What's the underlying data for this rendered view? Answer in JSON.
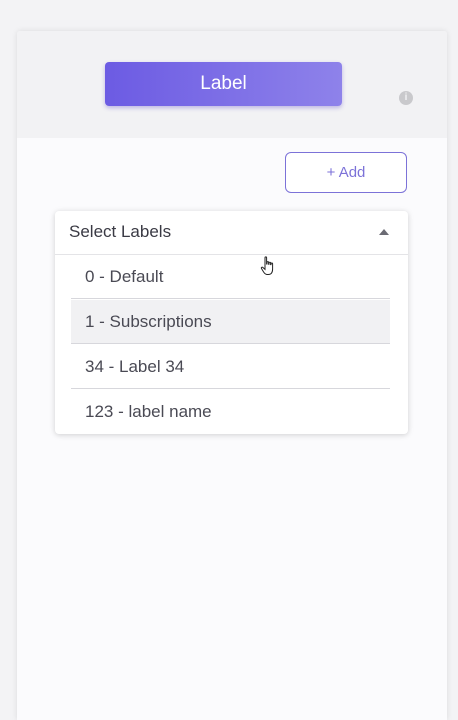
{
  "header": {
    "label_button": "Label",
    "info_icon": "info-icon",
    "info_glyph": "i"
  },
  "toolbar": {
    "add_label": "+ Add"
  },
  "select": {
    "placeholder": "Select Labels",
    "caret_icon": "caret-up-icon",
    "options": [
      {
        "label": "0 - Default"
      },
      {
        "label": "1 - Subscriptions",
        "highlighted": true
      },
      {
        "label": "34 - Label 34"
      },
      {
        "label": "123 - label name"
      }
    ]
  },
  "colors": {
    "accent": "#7c72d8",
    "button_gradient_start": "#6c5be3",
    "button_gradient_end": "#8e82ea",
    "highlight_row": "#f1f1f3"
  }
}
